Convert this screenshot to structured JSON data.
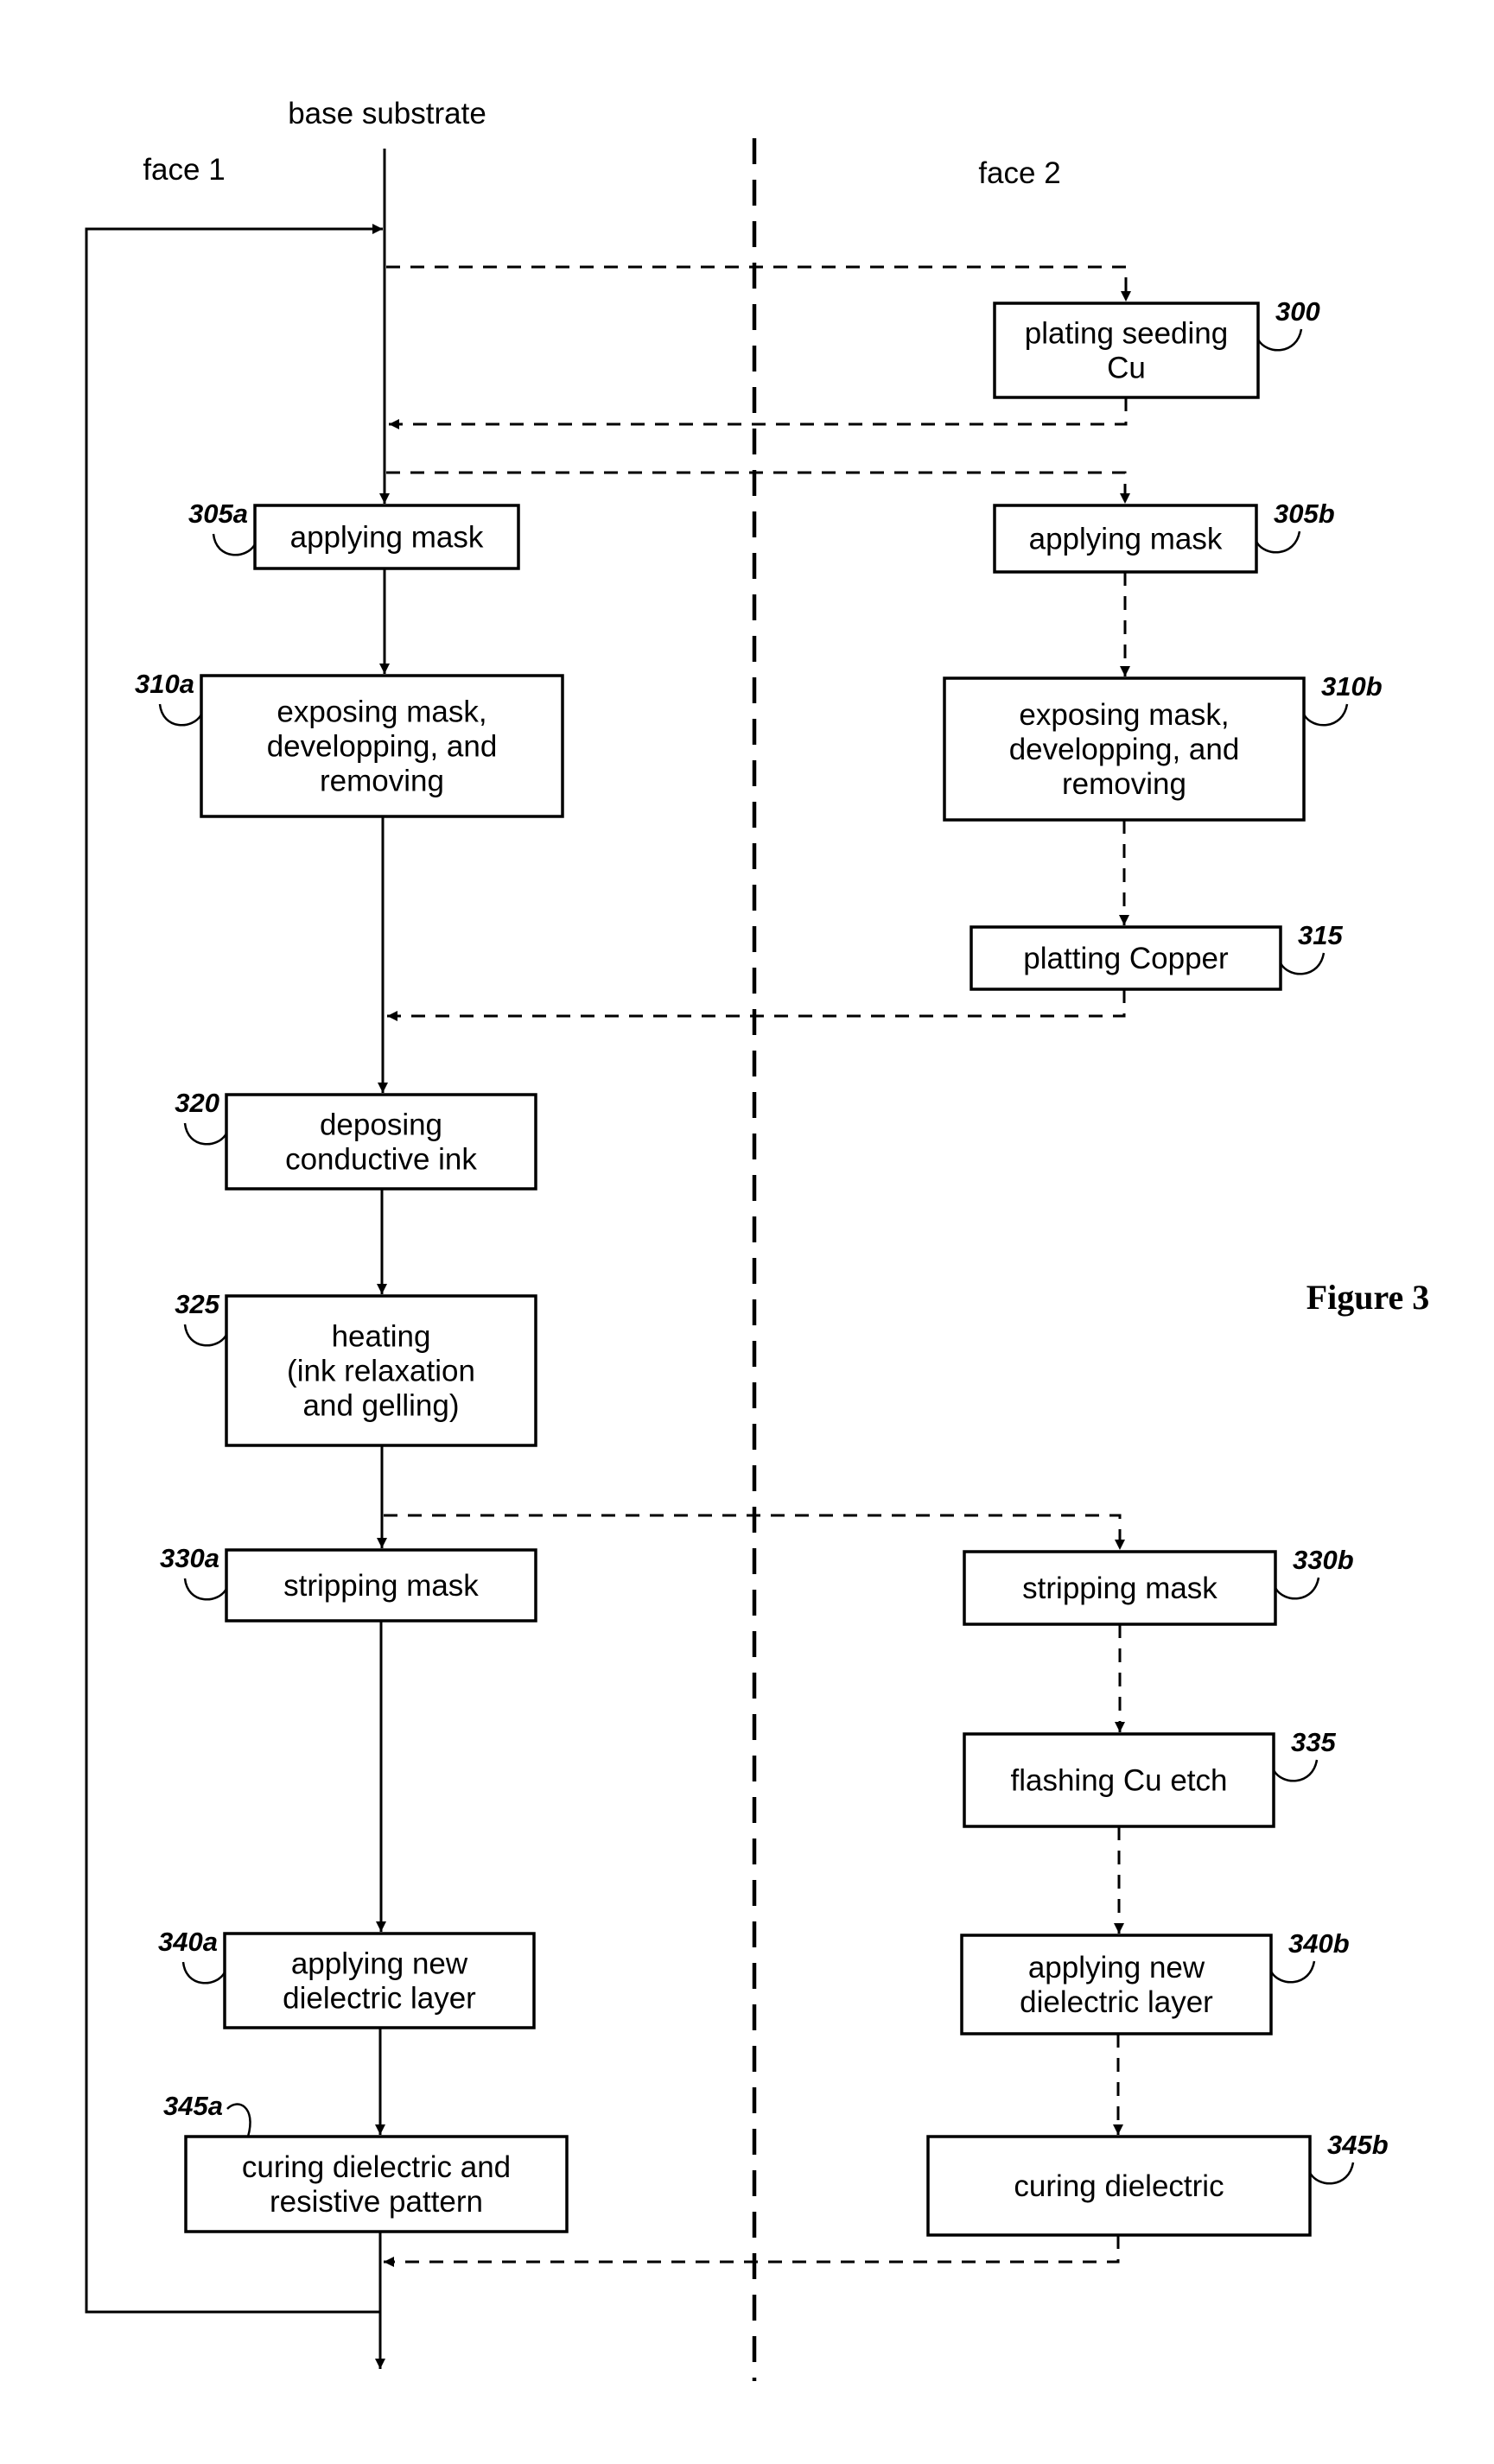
{
  "figure": {
    "title": "Figure 3",
    "start_label": "base substrate",
    "face1_label": "face 1",
    "face2_label": "face 2"
  },
  "steps": {
    "s300": {
      "ref": "300",
      "lines": [
        "plating seeding",
        "Cu"
      ]
    },
    "s305a": {
      "ref": "305a",
      "lines": [
        "applying mask"
      ]
    },
    "s305b": {
      "ref": "305b",
      "lines": [
        "applying mask"
      ]
    },
    "s310a": {
      "ref": "310a",
      "lines": [
        "exposing mask,",
        "developping, and",
        "removing"
      ]
    },
    "s310b": {
      "ref": "310b",
      "lines": [
        "exposing mask,",
        "developping, and",
        "removing"
      ]
    },
    "s315": {
      "ref": "315",
      "lines": [
        "platting Copper"
      ]
    },
    "s320": {
      "ref": "320",
      "lines": [
        "deposing",
        "conductive ink"
      ]
    },
    "s325": {
      "ref": "325",
      "lines": [
        "heating",
        "(ink relaxation",
        "and gelling)"
      ]
    },
    "s330a": {
      "ref": "330a",
      "lines": [
        "stripping mask"
      ]
    },
    "s330b": {
      "ref": "330b",
      "lines": [
        "stripping mask"
      ]
    },
    "s335": {
      "ref": "335",
      "lines": [
        "flashing Cu etch"
      ]
    },
    "s340a": {
      "ref": "340a",
      "lines": [
        "applying new",
        "dielectric layer"
      ]
    },
    "s340b": {
      "ref": "340b",
      "lines": [
        "applying new",
        "dielectric layer"
      ]
    },
    "s345a": {
      "ref": "345a",
      "lines": [
        "curing dielectric and",
        "resistive pattern"
      ]
    },
    "s345b": {
      "ref": "345b",
      "lines": [
        "curing dielectric"
      ]
    }
  },
  "flow": {
    "face1_sequence": [
      "305a",
      "310a",
      "320",
      "325",
      "330a",
      "340a",
      "345a"
    ],
    "face2_sequence": [
      "300",
      "305b",
      "310b",
      "315",
      "330b",
      "335",
      "340b",
      "345b"
    ],
    "loop": "345a returns to base substrate input"
  }
}
